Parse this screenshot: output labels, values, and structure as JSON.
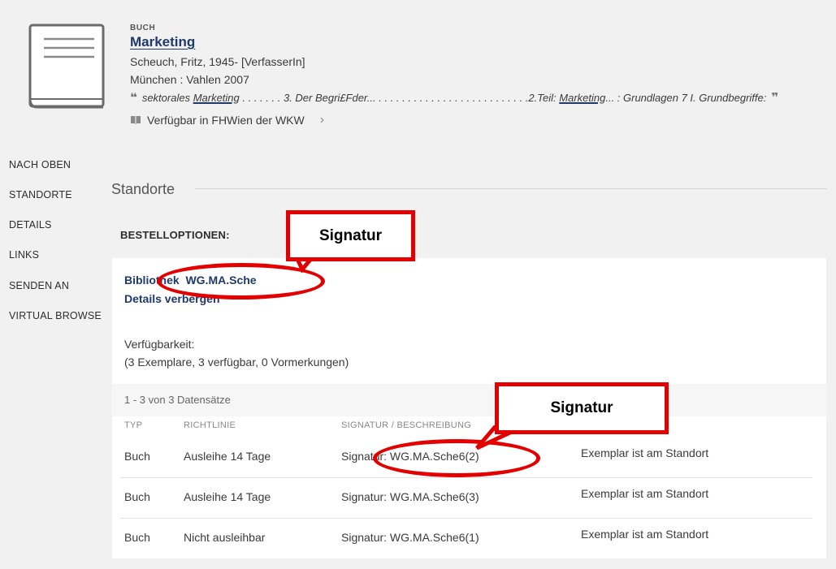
{
  "record": {
    "type": "BUCH",
    "title": "Marketing",
    "author": "Scheuch, Fritz, 1945- [VerfasserIn]",
    "publication": "München : Vahlen 2007",
    "snippet_pre": "sektorales ",
    "snippet_hl1": "Marketing",
    "snippet_mid": " . . . . . . . 3. Der Begri£Fder... . . . . . . . . . . . . . . . . . . . . . . . . . .2.Teil: ",
    "snippet_hl2": "Marketing",
    "snippet_post": "... : Grundlagen 7 I. Grundbegriffe:",
    "availability": "Verfügbar in FHWien der WKW"
  },
  "nav": {
    "items": [
      "NACH OBEN",
      "STANDORTE",
      "DETAILS",
      "LINKS",
      "SENDEN AN",
      "VIRTUAL BROWSE"
    ]
  },
  "section": {
    "title": "Standorte",
    "order_options": "BESTELLOPTIONEN:"
  },
  "location": {
    "library_label": "Bibliothek",
    "call_number": "WG.MA.Sche",
    "details_toggle": "Details verbergen",
    "availability_label": "Verfügbarkeit:",
    "availability_counts": "(3 Exemplare, 3 verfügbar, 0 Vormerkungen)",
    "records_count": "1 - 3 von 3 Datensätze"
  },
  "table": {
    "headers": [
      "TYP",
      "RICHTLINIE",
      "SIGNATUR / BESCHREIBUNG"
    ],
    "rows": [
      {
        "type": "Buch",
        "policy": "Ausleihe 14 Tage",
        "signature": "Signatur: WG.MA.Sche6(2)",
        "status": "Exemplar ist am Standort"
      },
      {
        "type": "Buch",
        "policy": "Ausleihe 14 Tage",
        "signature": "Signatur: WG.MA.Sche6(3)",
        "status": "Exemplar ist am Standort"
      },
      {
        "type": "Buch",
        "policy": "Nicht ausleihbar",
        "signature": "Signatur: WG.MA.Sche6(1)",
        "status": "Exemplar ist am Standort"
      }
    ]
  },
  "annotations": {
    "callout_1": "Signatur",
    "callout_2": "Signatur",
    "color": "#e30000"
  },
  "icons": {
    "book_cover": "book-icon",
    "open_quote": "quote-open-icon",
    "close_quote": "quote-close-icon",
    "availability": "book-open-icon",
    "chevron": "chevron-right-icon"
  }
}
